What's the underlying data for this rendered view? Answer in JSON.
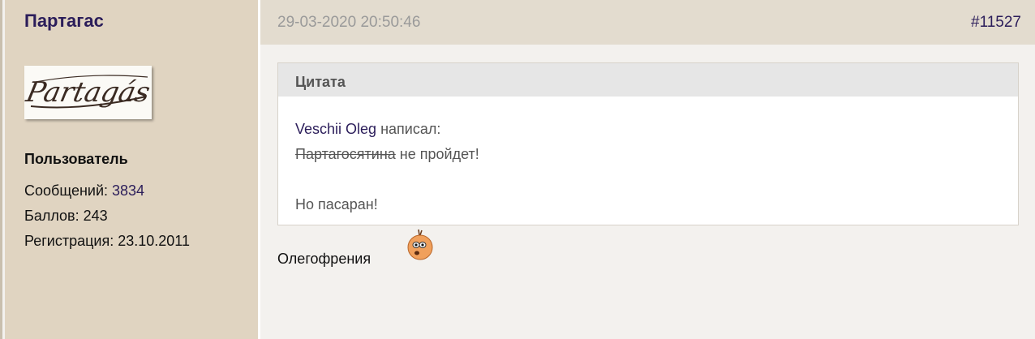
{
  "author": {
    "name": "Партагас",
    "avatar_text": "Partagás",
    "role": "Пользователь",
    "messages_label": "Сообщений: ",
    "messages_count": "3834",
    "points": "Баллов: 243",
    "registration": "Регистрация: 23.10.2011"
  },
  "post": {
    "datetime": "29-03-2020 20:50:46",
    "number": "#11527",
    "quote": {
      "title": "Цитата",
      "author": "Veschii Oleg",
      "wrote": " написал:",
      "struck_text": "Партагосятина",
      "line1_rest": " не пройдет!",
      "line2": "Но пасаран!"
    },
    "text": "Олегофрения",
    "smiley": "confused-smiley-icon"
  },
  "colors": {
    "sidebar_bg": "#e0d4c1",
    "header_bg": "#e3dccf",
    "link": "#2b1d5a",
    "body_bg": "#f3f1ee"
  }
}
